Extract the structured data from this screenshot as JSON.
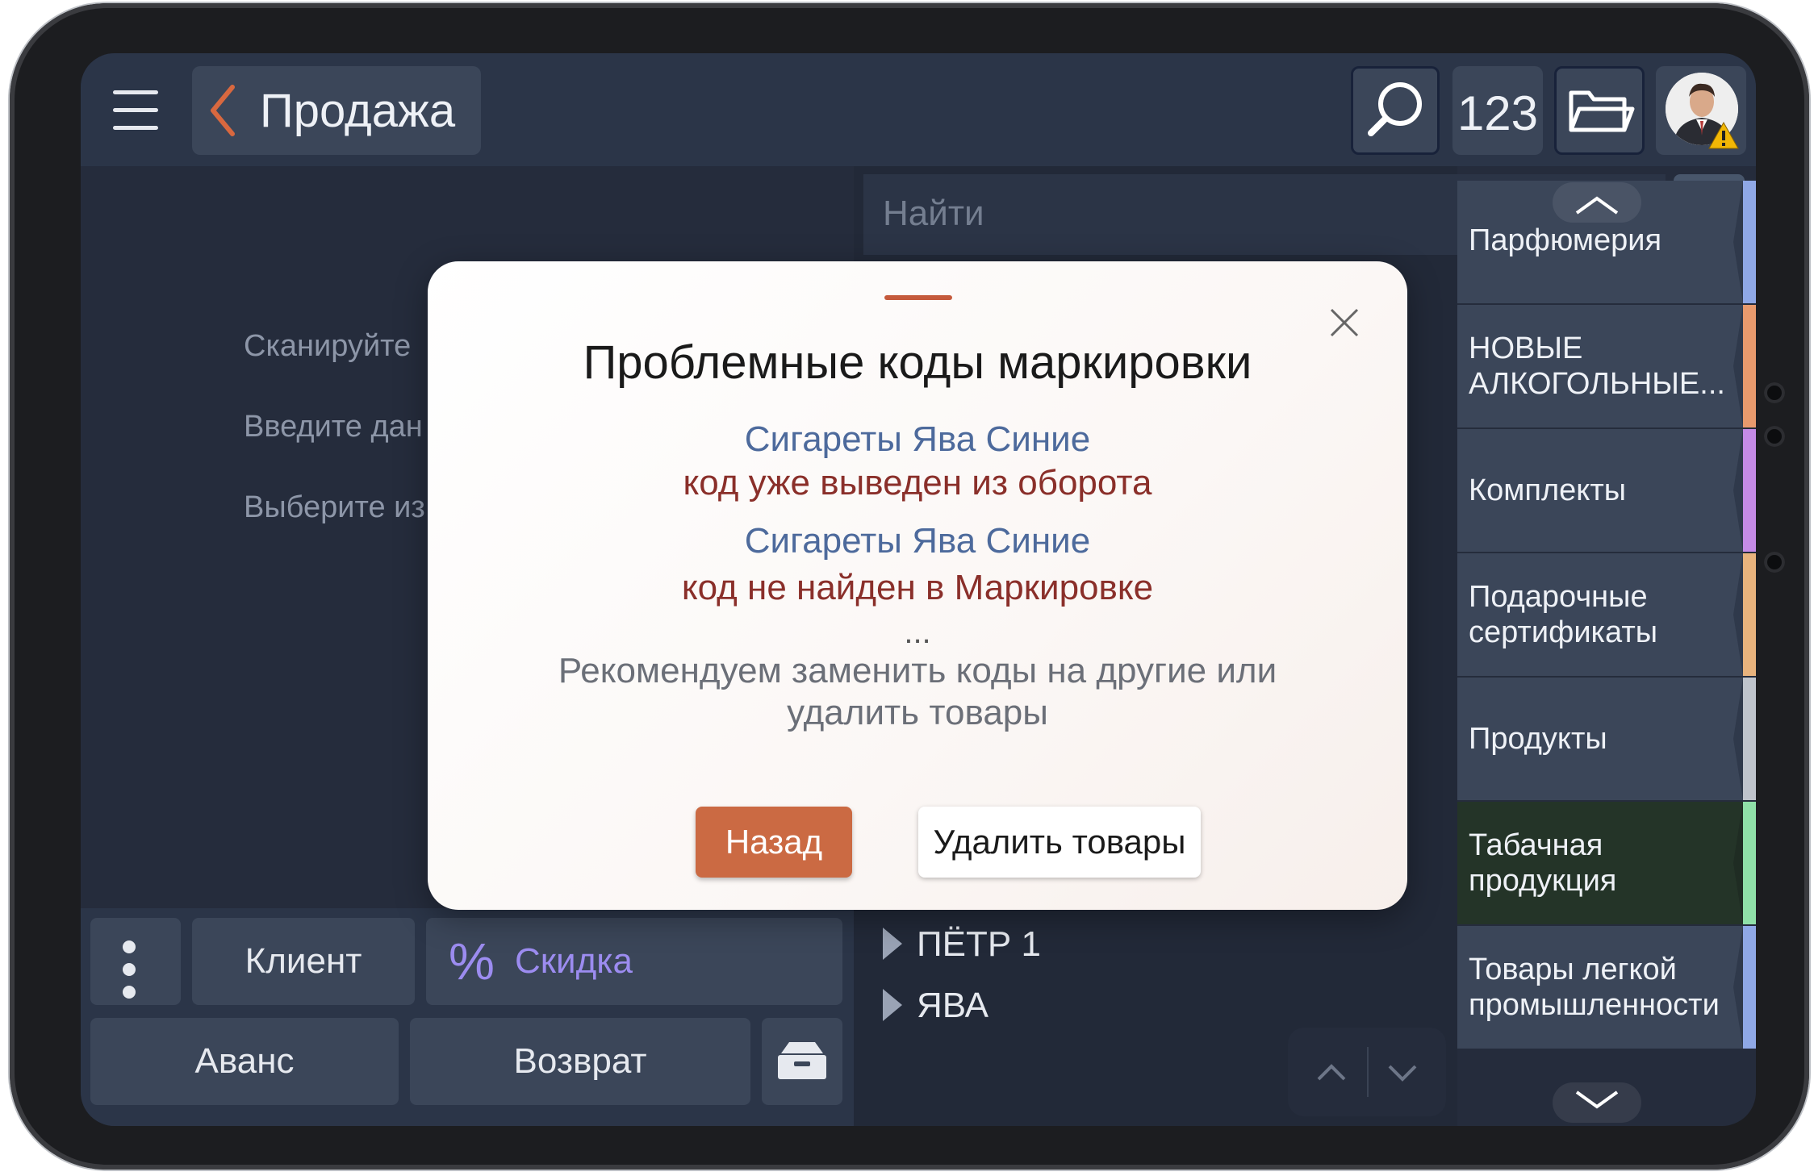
{
  "header": {
    "back_label": "Продажа",
    "numpad_label": "123"
  },
  "main": {
    "hints": [
      "Сканируйте",
      "Введите дан",
      "Выберите из"
    ],
    "search_placeholder": "Найти",
    "add_label": "+"
  },
  "categories": [
    {
      "label": "Парфюмерия",
      "color": "#8fa8e6"
    },
    {
      "label": "НОВЫЕ АЛКОГОЛЬНЫЕ...",
      "color": "#e89a6d"
    },
    {
      "label": "Комплекты",
      "color": "#c58be6"
    },
    {
      "label": "Подарочные сертификаты",
      "color": "#e8b37d"
    },
    {
      "label": "Продукты",
      "color": "#bfc4cc"
    },
    {
      "label": "Табачная продукция",
      "color": "#8fe0a8",
      "active": true
    },
    {
      "label": "Товары легкой промышленности",
      "color": "#8fa8e6"
    }
  ],
  "tree": [
    {
      "label": "ПЁТР 1"
    },
    {
      "label": "ЯВА"
    }
  ],
  "bottom": {
    "client_label": "Клиент",
    "discount_label": "Скидка",
    "discount_symbol": "%",
    "advance_label": "Аванс",
    "return_label": "Возврат"
  },
  "modal": {
    "title": "Проблемные коды маркировки",
    "items": [
      {
        "name": "Сигареты Ява Синие",
        "error": "код уже выведен из оборота"
      },
      {
        "name": "Сигареты Ява Синие",
        "error": "код не найден в Маркировке"
      }
    ],
    "ellipsis": "...",
    "recommendation": "Рекомендуем заменить коды на другие или удалить товары",
    "back_button": "Назад",
    "delete_button": "Удалить товары"
  },
  "colors": {
    "accent": "#cb6a43",
    "discount": "#9c8cf0",
    "topbar": "#2b3548",
    "surface": "#252c3c"
  }
}
